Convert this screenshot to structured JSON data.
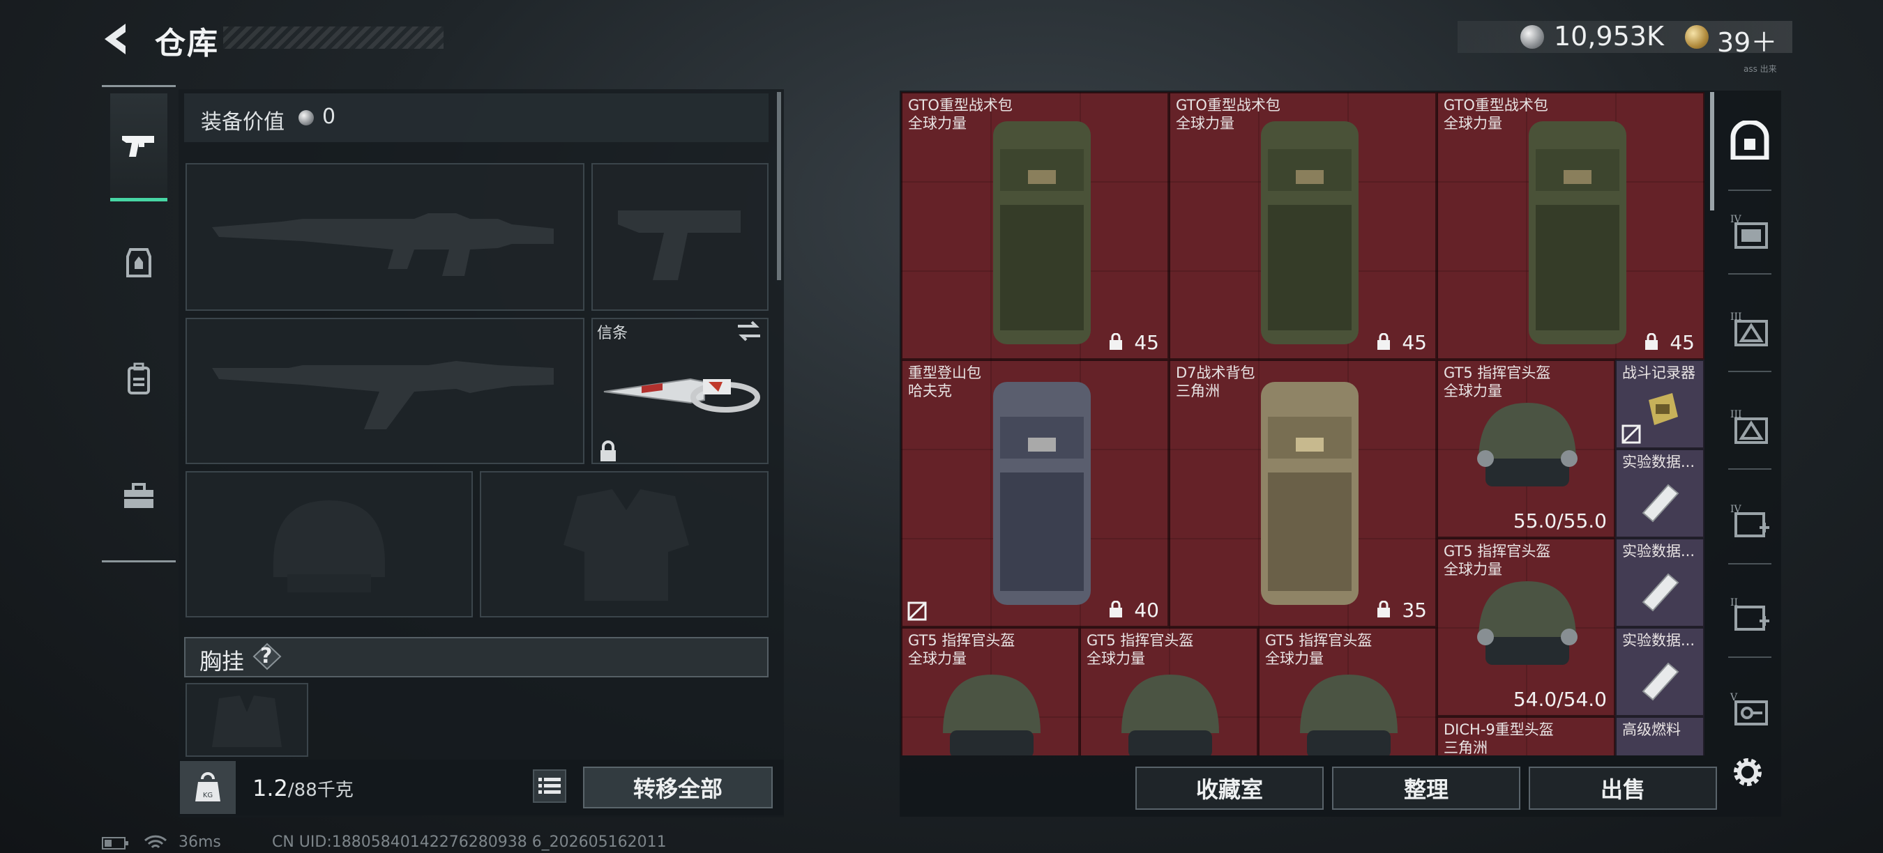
{
  "header": {
    "title": "仓库",
    "silver_amount": "10,953K",
    "gold_amount": "39＋",
    "version_tag": "ass 出来"
  },
  "left_tabs": [
    "pistol-icon",
    "armor-icon",
    "backpack-icon",
    "toolbox-icon"
  ],
  "loadout": {
    "equip_value_label": "装备价值",
    "equip_value": "0",
    "knife_label": "信条",
    "chest_rig_label": "胸挂",
    "help": "?",
    "weight_current": "1.2",
    "weight_max": "/88千克",
    "transfer_all_label": "转移全部"
  },
  "stash_items": [
    {
      "name": "GTO重型战术包\n全球力量",
      "qty": "45"
    },
    {
      "name": "GTO重型战术包\n全球力量",
      "qty": "45"
    },
    {
      "name": "GTO重型战术包\n全球力量",
      "qty": "45"
    },
    {
      "name": "重型登山包\n哈夫克",
      "qty": "40"
    },
    {
      "name": "D7战术背包\n三角洲",
      "qty": "35"
    },
    {
      "name": "GT5 指挥官头盔\n全球力量",
      "durability": "55.0/55.0"
    },
    {
      "name": "战斗记录器"
    },
    {
      "name": "实验数据..."
    },
    {
      "name": "GT5 指挥官头盔\n全球力量",
      "durability": "54.0/54.0"
    },
    {
      "name": "实验数据..."
    },
    {
      "name": "GT5 指挥官头盔\n全球力量"
    },
    {
      "name": "GT5 指挥官头盔\n全球力量"
    },
    {
      "name": "GT5 指挥官头盔\n全球力量"
    },
    {
      "name": "实验数据..."
    },
    {
      "name": "DICH-9重型头盔\n三角洲"
    },
    {
      "name": "高级燃料"
    }
  ],
  "actions": {
    "collection_label": "收藏室",
    "sort_label": "整理",
    "sell_label": "出售"
  },
  "status_bar": {
    "ping": "36ms",
    "uid": "CN UID:18805840142276280938 6_202605162011"
  },
  "colors": {
    "accent": "#47d6a4",
    "stash_bg": "#5c1f25",
    "item_blue": "#3e425c"
  }
}
